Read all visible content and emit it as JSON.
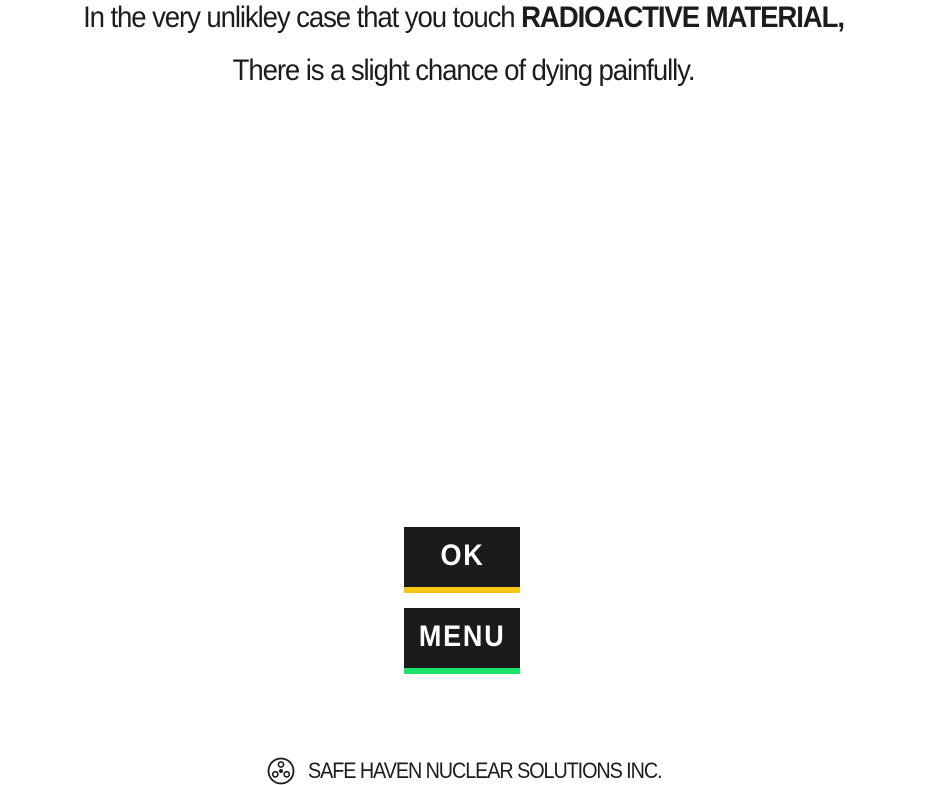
{
  "message": {
    "line1_prefix": "In the very unlikley case that you touch ",
    "line1_emphasis": "RADIOACTIVE MATERIAL",
    "line1_suffix": ",",
    "line2": "There is a slight chance of dying painfully."
  },
  "buttons": {
    "ok_label": "OK",
    "menu_label": "MENU"
  },
  "footer": {
    "icon": "radiation-trefoil-icon",
    "company": "SAFE HAVEN NUCLEAR SOLUTIONS INC."
  },
  "colors": {
    "button_bg": "#1b1b1b",
    "ok_accent": "#f5c518",
    "menu_accent": "#1ee36a"
  }
}
